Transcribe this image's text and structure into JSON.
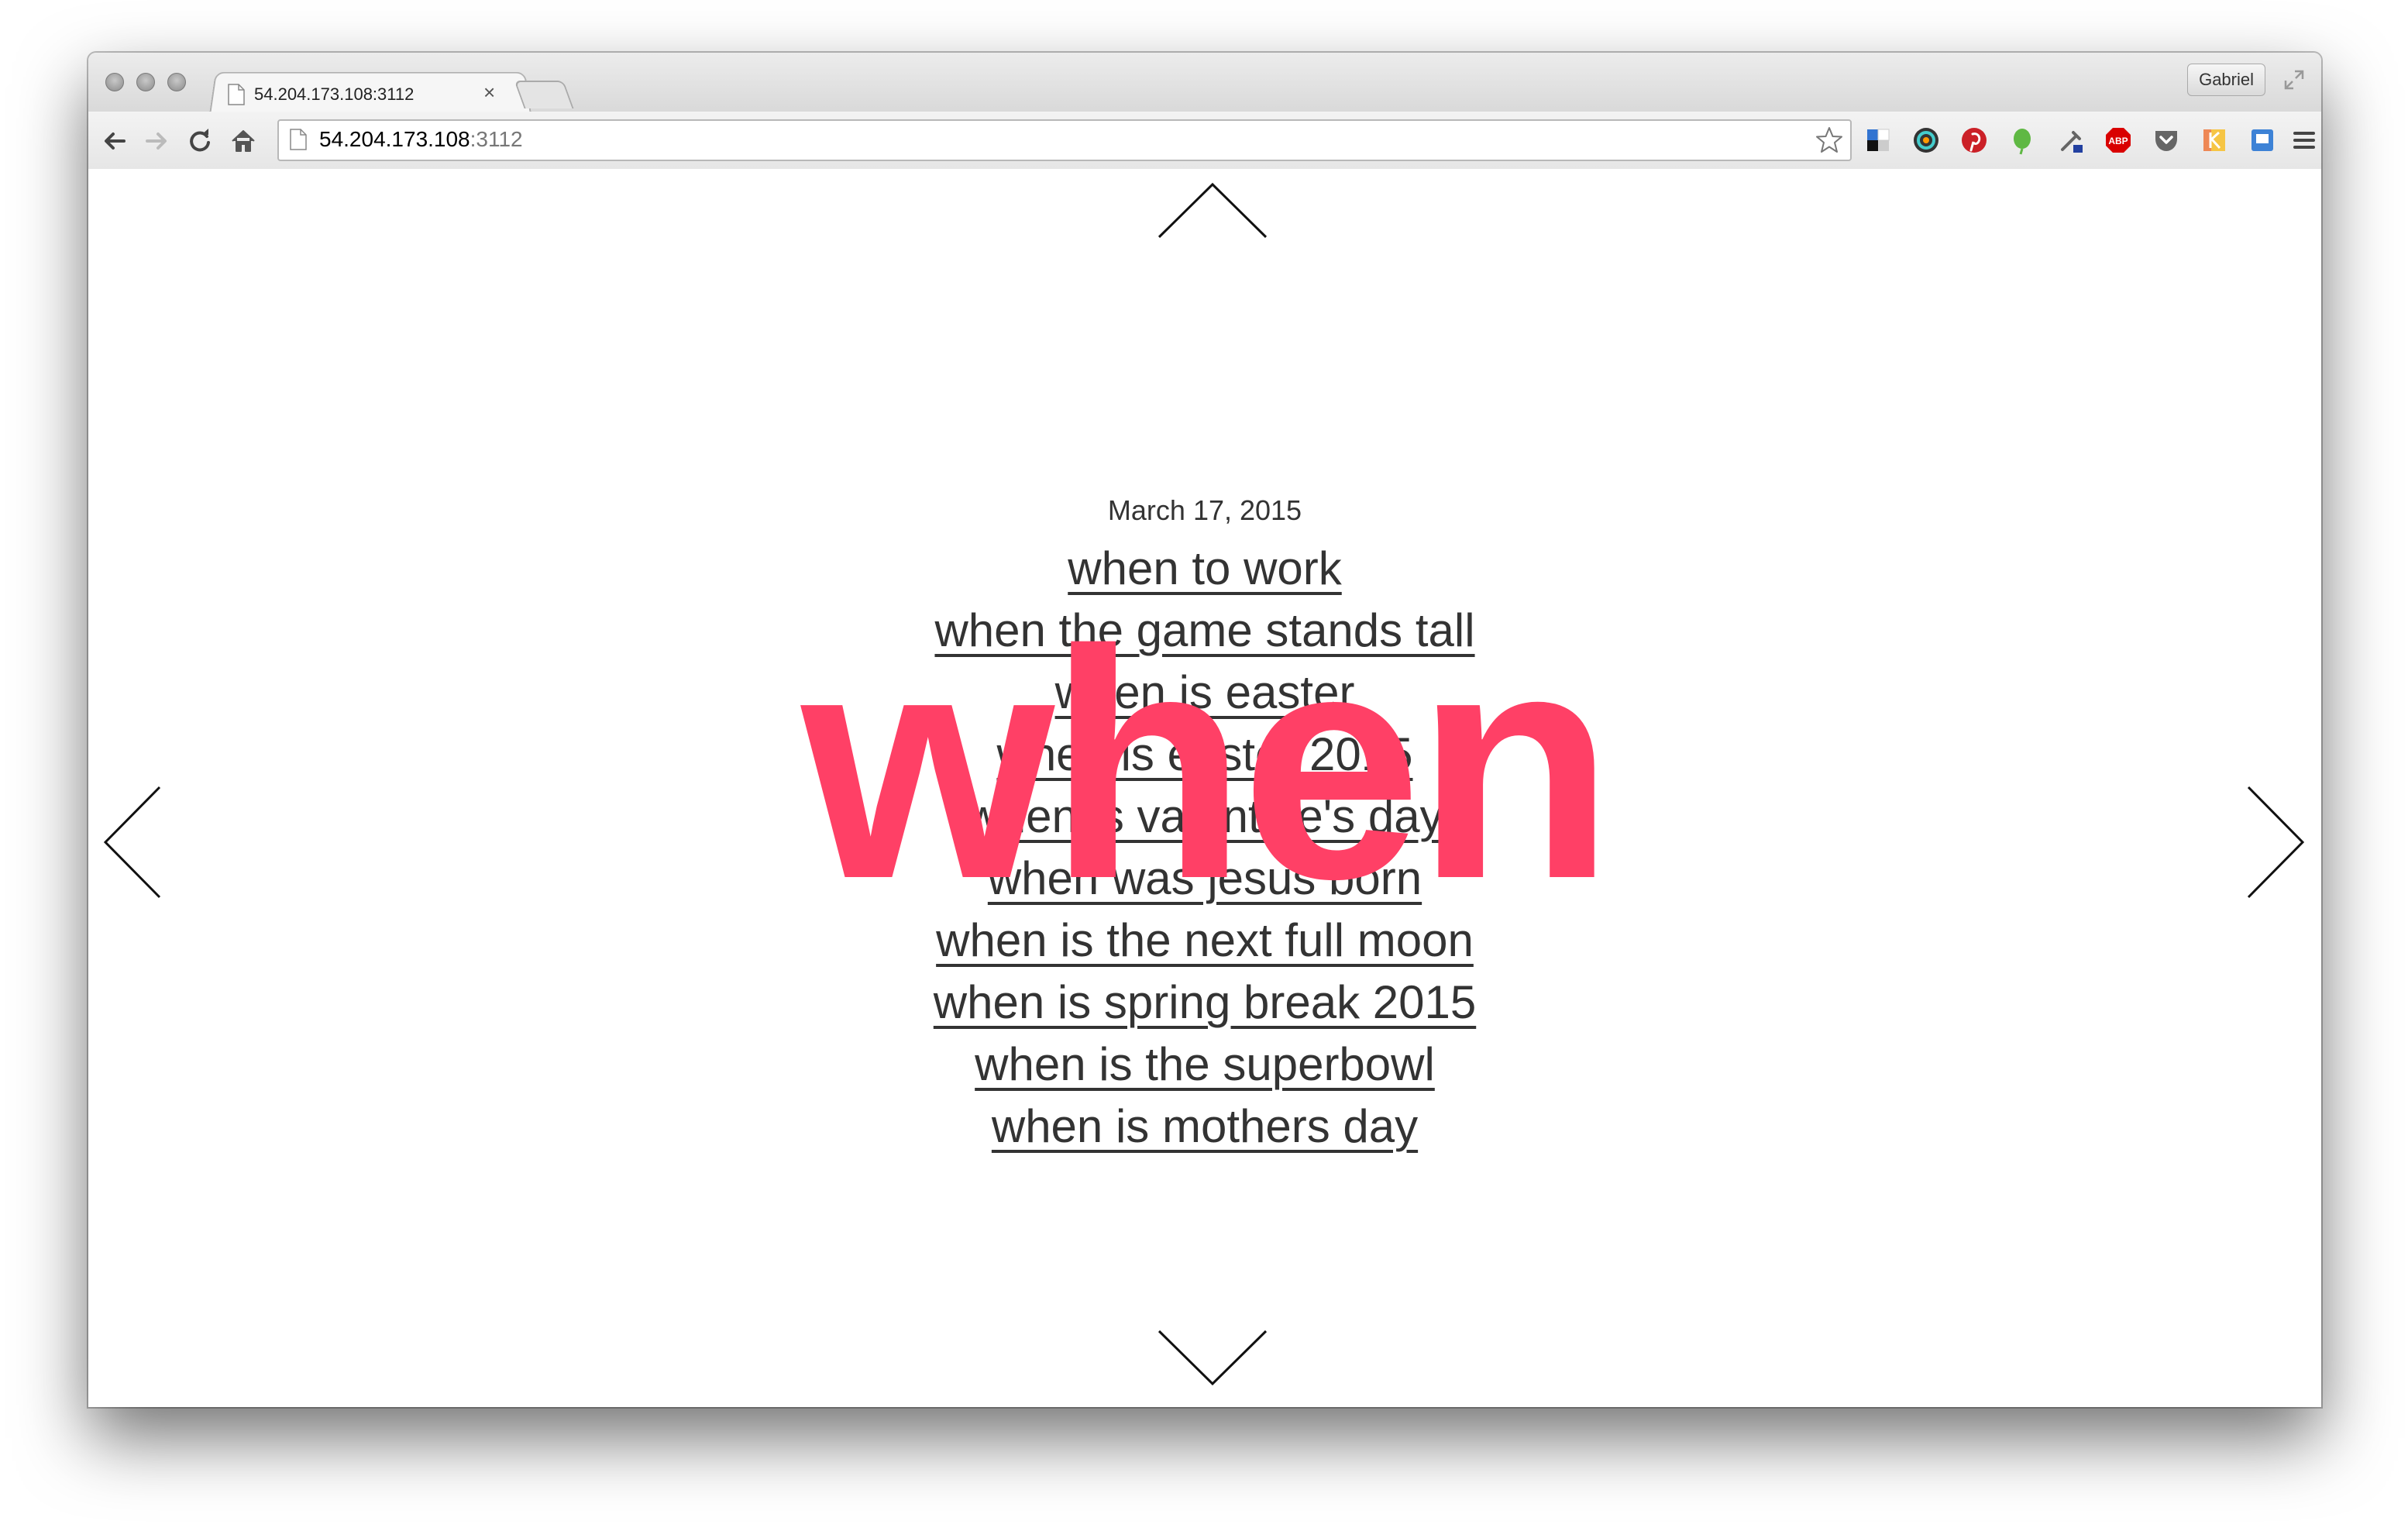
{
  "browser": {
    "tab_title": "54.204.173.108:3112",
    "tab_close": "×",
    "profile_name": "Gabriel",
    "url_host": "54.204.173.108",
    "url_port": ":3112",
    "extensions": [
      "delicious-icon",
      "colorpicker-icon",
      "pinterest-icon",
      "evernote-icon",
      "eyedropper-icon",
      "adblock-plus-icon",
      "pocket-icon",
      "klout-icon",
      "screenshot-icon"
    ]
  },
  "page": {
    "date": "March 17, 2015",
    "keyword": "when",
    "keyword_color": "#ff4066",
    "suggestions": [
      "when to work",
      "when the game stands tall",
      "when is easter",
      "when is easter 2015",
      "when is valentine's day",
      "when was jesus born",
      "when is the next full moon",
      "when is spring break 2015",
      "when is the superbowl",
      "when is mothers day"
    ]
  }
}
